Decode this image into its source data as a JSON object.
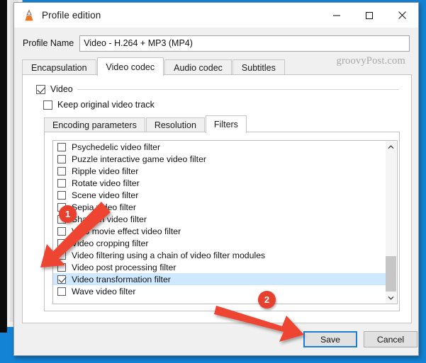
{
  "window": {
    "title": "Profile edition",
    "app_icon": "vlc-cone-icon",
    "controls": {
      "minimize": "minimize-icon",
      "maximize": "maximize-icon",
      "close": "close-icon"
    }
  },
  "watermark": "groovyPost.com",
  "profile": {
    "label": "Profile Name",
    "value": "Video - H.264 + MP3 (MP4)",
    "placeholder": "Profile Name"
  },
  "outer_tabs": [
    {
      "label": "Encapsulation",
      "active": false
    },
    {
      "label": "Video codec",
      "active": true
    },
    {
      "label": "Audio codec",
      "active": false
    },
    {
      "label": "Subtitles",
      "active": false
    }
  ],
  "video_group": {
    "title": "Video",
    "checked": true,
    "keep_original": {
      "label": "Keep original video track",
      "checked": false
    }
  },
  "inner_tabs": [
    {
      "label": "Encoding parameters",
      "active": false
    },
    {
      "label": "Resolution",
      "active": false
    },
    {
      "label": "Filters",
      "active": true
    }
  ],
  "filters": [
    {
      "label": "Psychedelic video filter",
      "checked": false,
      "selected": false
    },
    {
      "label": "Puzzle interactive game video filter",
      "checked": false,
      "selected": false
    },
    {
      "label": "Ripple video filter",
      "checked": false,
      "selected": false
    },
    {
      "label": "Rotate video filter",
      "checked": false,
      "selected": false
    },
    {
      "label": "Scene video filter",
      "checked": false,
      "selected": false
    },
    {
      "label": "Sepia video filter",
      "checked": false,
      "selected": false
    },
    {
      "label": "Sharpen video filter",
      "checked": false,
      "selected": false
    },
    {
      "label": "VHS movie effect video filter",
      "checked": false,
      "selected": false
    },
    {
      "label": "Video cropping filter",
      "checked": false,
      "selected": false
    },
    {
      "label": "Video filtering using a chain of video filter modules",
      "checked": false,
      "selected": false
    },
    {
      "label": "Video post processing filter",
      "checked": false,
      "selected": false
    },
    {
      "label": "Video transformation filter",
      "checked": true,
      "selected": true
    },
    {
      "label": "Wave video filter",
      "checked": false,
      "selected": false
    }
  ],
  "scrollbar": {
    "up": "chevron-up-icon",
    "down": "chevron-down-icon"
  },
  "footer": {
    "save_label": "Save",
    "cancel_label": "Cancel"
  },
  "annotations": {
    "badge_1": "1",
    "badge_2": "2",
    "color": "#e8402f"
  },
  "colors": {
    "accent_blue": "#1a7fd4",
    "selection": "#cde8ff",
    "desktop": "#1383d6",
    "annotation_red": "#e8402f"
  }
}
